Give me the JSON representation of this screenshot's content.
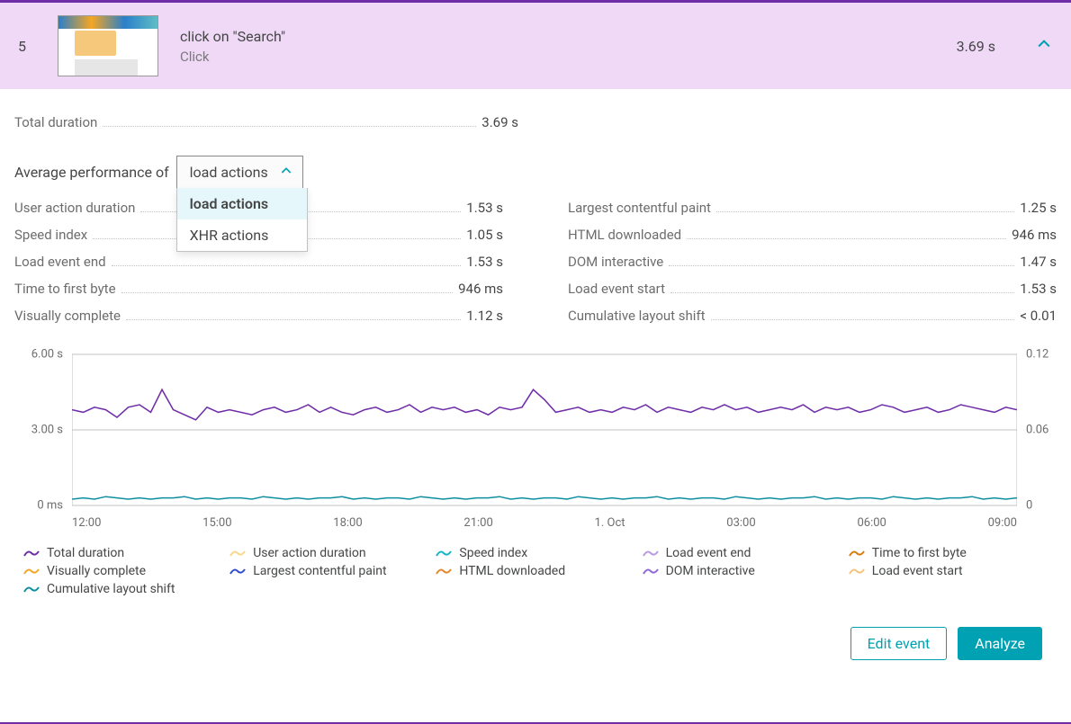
{
  "header": {
    "index": "5",
    "title": "click on \"Search\"",
    "subtitle": "Click",
    "time": "3.69 s"
  },
  "total": {
    "label": "Total duration",
    "value": "3.69 s"
  },
  "avg_label": "Average performance of",
  "dropdown": {
    "selected": "load actions",
    "options": [
      "load actions",
      "XHR actions"
    ]
  },
  "metrics_left": [
    {
      "label": "User action duration",
      "value": "1.53 s"
    },
    {
      "label": "Speed index",
      "value": "1.05 s"
    },
    {
      "label": "Load event end",
      "value": "1.53 s"
    },
    {
      "label": "Time to first byte",
      "value": "946 ms"
    },
    {
      "label": "Visually complete",
      "value": "1.12 s"
    }
  ],
  "metrics_right": [
    {
      "label": "Largest contentful paint",
      "value": "1.25 s"
    },
    {
      "label": "HTML downloaded",
      "value": "946 ms"
    },
    {
      "label": "DOM interactive",
      "value": "1.47 s"
    },
    {
      "label": "Load event start",
      "value": "1.53 s"
    },
    {
      "label": "Cumulative layout shift",
      "value": "< 0.01"
    }
  ],
  "legend": [
    {
      "name": "Total duration",
      "color": "#6f2da8"
    },
    {
      "name": "User action duration",
      "color": "#f9d68a"
    },
    {
      "name": "Speed index",
      "color": "#14b5c7"
    },
    {
      "name": "Load event end",
      "color": "#b99ae3"
    },
    {
      "name": "Time to first byte",
      "color": "#d97a0e"
    },
    {
      "name": "Visually complete",
      "color": "#f5a623"
    },
    {
      "name": "Largest contentful paint",
      "color": "#2e4fc9"
    },
    {
      "name": "HTML downloaded",
      "color": "#e6862a"
    },
    {
      "name": "DOM interactive",
      "color": "#8f67d8"
    },
    {
      "name": "Load event start",
      "color": "#f3c47a"
    },
    {
      "name": "Cumulative layout shift",
      "color": "#0e8fa0"
    }
  ],
  "buttons": {
    "edit": "Edit event",
    "analyze": "Analyze"
  },
  "chart_data": {
    "type": "line",
    "x_ticks": [
      "12:00",
      "15:00",
      "18:00",
      "21:00",
      "1. Oct",
      "03:00",
      "06:00",
      "09:00"
    ],
    "y_left": {
      "max": 6.0,
      "ticks": [
        "6.00 s",
        "3.00 s",
        "0 ms"
      ]
    },
    "y_right": {
      "max": 0.12,
      "ticks": [
        "0.12",
        "0.06",
        "0"
      ]
    },
    "series": [
      {
        "name": "Total duration",
        "color": "#6f2da8",
        "values": [
          3.8,
          3.7,
          3.9,
          3.8,
          3.5,
          3.9,
          4.0,
          3.7,
          4.6,
          3.8,
          3.6,
          3.4,
          3.9,
          3.7,
          3.8,
          3.7,
          3.6,
          3.8,
          3.9,
          3.7,
          3.8,
          4.0,
          3.7,
          3.9,
          3.7,
          3.6,
          3.8,
          3.9,
          3.7,
          3.8,
          4.0,
          3.7,
          3.9,
          3.8,
          3.9,
          3.7,
          3.8,
          3.6,
          3.9,
          3.8,
          3.9,
          4.6,
          4.2,
          3.7,
          3.8,
          3.9,
          3.7,
          3.8,
          3.7,
          3.9,
          3.8,
          4.0,
          3.7,
          3.9,
          3.8,
          3.7,
          3.9,
          3.8,
          4.0,
          3.8,
          3.9,
          3.7,
          3.8,
          3.9,
          3.8,
          4.0,
          3.7,
          3.9,
          3.8,
          3.9,
          3.7,
          3.8,
          4.0,
          3.9,
          3.7,
          3.8,
          3.9,
          3.7,
          3.8,
          4.0,
          3.9,
          3.8,
          3.7,
          3.9,
          3.8
        ]
      },
      {
        "name": "Cumulative layout shift",
        "color": "#0e8fa0",
        "values": [
          0.005,
          0.006,
          0.005,
          0.007,
          0.006,
          0.005,
          0.006,
          0.005,
          0.006,
          0.006,
          0.007,
          0.005,
          0.006,
          0.005,
          0.006,
          0.006,
          0.005,
          0.007,
          0.006,
          0.005,
          0.006,
          0.005,
          0.006,
          0.006,
          0.007,
          0.005,
          0.006,
          0.005,
          0.006,
          0.006,
          0.005,
          0.007,
          0.006,
          0.005,
          0.006,
          0.005,
          0.006,
          0.006,
          0.007,
          0.005,
          0.006,
          0.005,
          0.006,
          0.006,
          0.005,
          0.007,
          0.006,
          0.005,
          0.006,
          0.005,
          0.006,
          0.006,
          0.007,
          0.005,
          0.006,
          0.005,
          0.006,
          0.006,
          0.005,
          0.007,
          0.006,
          0.005,
          0.006,
          0.005,
          0.006,
          0.006,
          0.007,
          0.005,
          0.006,
          0.005,
          0.006,
          0.006,
          0.005,
          0.007,
          0.006,
          0.005,
          0.006,
          0.005,
          0.006,
          0.006,
          0.007,
          0.005,
          0.006,
          0.005,
          0.006
        ]
      }
    ]
  }
}
